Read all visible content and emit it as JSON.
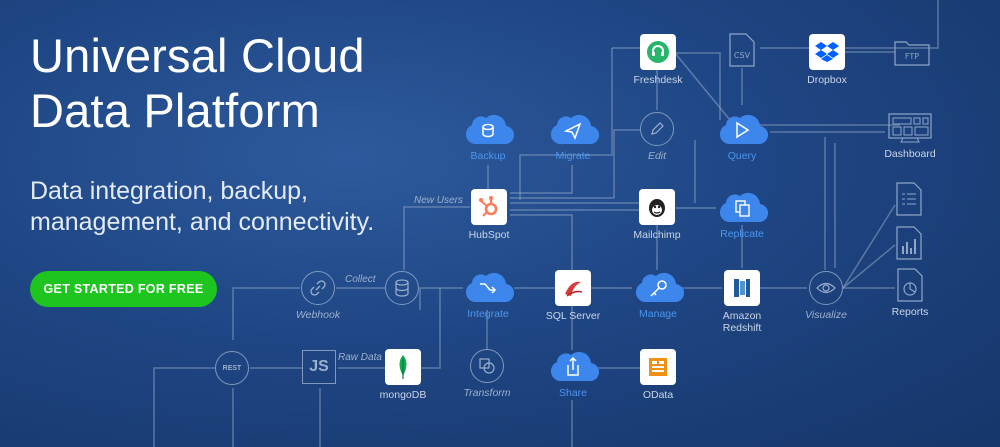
{
  "hero": {
    "title_line1": "Universal Cloud",
    "title_line2": "Data Platform",
    "subtitle_line1": "Data integration, backup,",
    "subtitle_line2": "management, and connectivity.",
    "cta_label": "GET STARTED FOR FREE"
  },
  "colors": {
    "cta": "#1ec51e",
    "cloud": "#3d86ec",
    "background": "#1f4684"
  },
  "diagram": {
    "csv": "CSV",
    "ftp": "FTP",
    "freshdesk": "Freshdesk",
    "dropbox": "Dropbox",
    "backup": "Backup",
    "migrate": "Migrate",
    "edit": "Edit",
    "query": "Query",
    "dashboard": "Dashboard",
    "hubspot": "HubSpot",
    "mailchimp": "Mailchimp",
    "replicate": "Replicate",
    "new_users": "New Users",
    "collect": "Collect",
    "webhook": "Webhook",
    "integrate": "Integrate",
    "sql_server": "SQL Server",
    "manage": "Manage",
    "amazon_redshift_line1": "Amazon",
    "amazon_redshift_line2": "Redshift",
    "visualize": "Visualize",
    "reports": "Reports",
    "rest": "REST",
    "js": "JS",
    "raw_data": "Raw Data",
    "mongodb": "mongoDB",
    "transform": "Transform",
    "share": "Share",
    "odata": "OData"
  }
}
